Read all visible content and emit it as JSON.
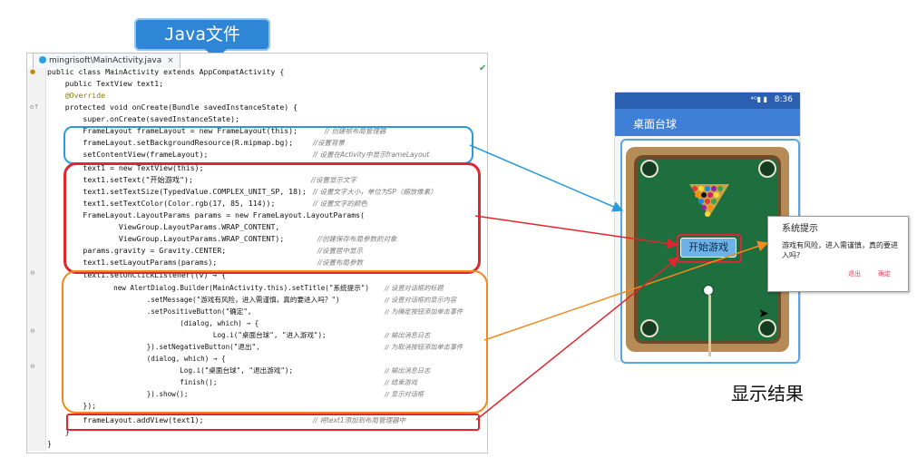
{
  "callout": {
    "label": "Java文件"
  },
  "editor": {
    "tab_label": "mingrisoft\\MainActivity.java",
    "tab_close": "×",
    "code": {
      "l01": "public class MainActivity extends AppCompatActivity {",
      "l02": "    public TextView text1;",
      "l03": "    @Override",
      "l04": "    protected void onCreate(Bundle savedInstanceState) {",
      "l05": "        super.onCreate(savedInstanceState);",
      "l06": "        FrameLayout frameLayout = new FrameLayout(this);",
      "l06c": "// 创建帧布局管理器",
      "l07": "        frameLayout.setBackgroundResource(R.mipmap.bg);",
      "l07c": "//设置背景",
      "l08": "        setContentView(frameLayout);",
      "l08c": "// 设置在Activity中显示frameLayout",
      "l09": "        text1 = new TextView(this);",
      "l10": "        text1.setText(\"开始游戏\");",
      "l10c": "//设置显示文字",
      "l11": "        text1.setTextSize(TypedValue.COMPLEX_UNIT_SP, 18);",
      "l11c": "// 设置文字大小，单位为SP（缩放像素）",
      "l12": "        text1.setTextColor(Color.rgb(17, 85, 114));",
      "l12c": "// 设置文字的颜色",
      "l13": "        FrameLayout.LayoutParams params = new FrameLayout.LayoutParams(",
      "l14": "                ViewGroup.LayoutParams.WRAP_CONTENT,",
      "l15": "                ViewGroup.LayoutParams.WRAP_CONTENT);",
      "l15c": "//创建保存布局参数的对象",
      "l16": "        params.gravity = Gravity.CENTER;",
      "l16c": "//设置居中显示",
      "l17": "        text1.setLayoutParams(params);",
      "l17c": "//设置布局参数",
      "l18": "        text1.setOnClickListener((v) → {",
      "l19": "                new AlertDialog.Builder(MainActivity.this).setTitle(\"系统提示\")",
      "l19c": "// 设置对话框的标题",
      "l20": "                        .setMessage(\"游戏有风险，进入需谨慎，真的要进入吗？\")",
      "l20c": "// 设置对话框的显示内容",
      "l21": "                        .setPositiveButton(\"确定\",",
      "l21c": "// 为确定按钮添加单击事件",
      "l22": "                                (dialog, which) → {",
      "l23": "                                        Log.i(\"桌面台球\", \"进入游戏\");",
      "l23c": "// 输出消息日志",
      "l24": "                        }).setNegativeButton(\"退出\",",
      "l24c": "// 为取消按钮添加单击事件",
      "l25": "                        (dialog, which) → {",
      "l26": "                                Log.i(\"桌面台球\", \"退出游戏\");",
      "l26c": "// 输出消息日志",
      "l27": "                                finish();",
      "l27c": "// 结束游戏",
      "l28": "                        }).show();",
      "l28c": "// 显示对话框",
      "l29": "        });",
      "l30": "        frameLayout.addView(text1);",
      "l30c": "// 将text1添加到布局管理器中",
      "l31": "    }",
      "l32": "}"
    }
  },
  "phone": {
    "status_time": "8:36",
    "status_icons": "⁴ᴳ▮ ▮",
    "app_title": "桌面台球",
    "start_button": "开始游戏"
  },
  "dialog": {
    "title": "系统提示",
    "message": "游戏有风险，进入需谨慎，真的要进入吗?",
    "exit_button": "退出",
    "ok_button": "确定"
  },
  "result_label": "显示结果",
  "colors": {
    "blue": "#2a9ad9",
    "red": "#e0262f",
    "orange": "#f08a1c",
    "appbar": "#3f7fd6",
    "felt": "#1e6f3d"
  }
}
